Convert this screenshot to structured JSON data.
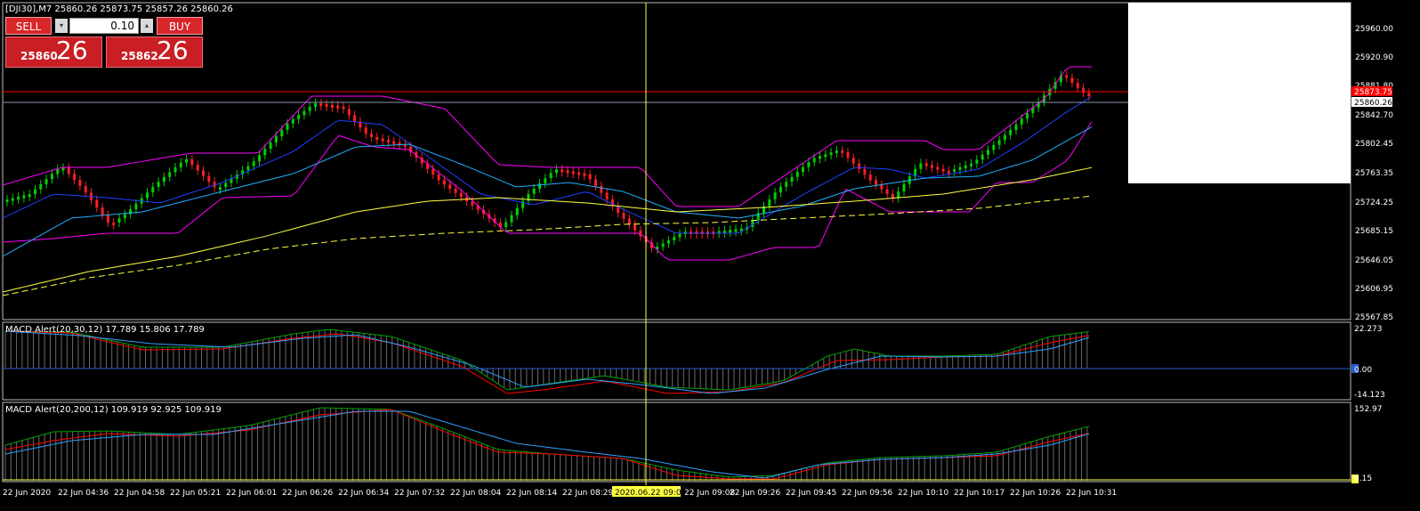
{
  "header": {
    "symbol_line": "[DJI30],M7  25860.26 25873.75 25857.26 25860.26"
  },
  "trade_panel": {
    "sell_label": "SELL",
    "buy_label": "BUY",
    "lot_value": "0.10",
    "dec_icon": "▾",
    "inc_icon": "▴",
    "sell_price_main": "25860",
    "sell_price_big": "26",
    "buy_price_main": "25862",
    "buy_price_big": "26"
  },
  "price_axis": {
    "labels": [
      "25960.00",
      "25920.90",
      "25881.80",
      "25842.70",
      "25802.45",
      "25763.35",
      "25724.25",
      "25685.15",
      "25646.05",
      "25606.95",
      "25567.85"
    ],
    "ask_label": "25873.75",
    "bid_label": "25860.26"
  },
  "macd1": {
    "title": "MACD Alert(20,30,12) 17.789 15.806 17.789",
    "labels": [
      "22.273",
      "0.00",
      "-14.123"
    ]
  },
  "macd2": {
    "title": "MACD Alert(20,200,12) 109.919 92.925 109.919",
    "labels": [
      "152.97",
      "6.15"
    ]
  },
  "time_axis": {
    "labels": [
      "22 Jun 2020",
      "22 Jun 04:36",
      "22 Jun 04:58",
      "22 Jun 05:21",
      "22 Jun 06:01",
      "22 Jun 06:26",
      "22 Jun 06:34",
      "22 Jun 07:32",
      "22 Jun 08:04",
      "22 Jun 08:14",
      "22 Jun 08:29",
      "22 Jun 09:08",
      "22 Jun 09:26",
      "22 Jun 09:45",
      "22 Jun 09:56",
      "22 Jun 10:10",
      "22 Jun 10:17",
      "22 Jun 10:26",
      "22 Jun 10:31"
    ],
    "crosshair_label": "2020.06.22 09:00"
  },
  "colors": {
    "bull": "#00d000",
    "bear": "#ff2020",
    "magenta": "#ff00ff",
    "blue": "#2040ff",
    "cyan": "#20b0ff",
    "yellow": "#ffff40",
    "ask_line": "#ff0000",
    "bid_line": "#8899aa",
    "macd_green": "#00a000",
    "macd_red": "#ff0000",
    "macd_blue": "#30a0ff"
  }
}
